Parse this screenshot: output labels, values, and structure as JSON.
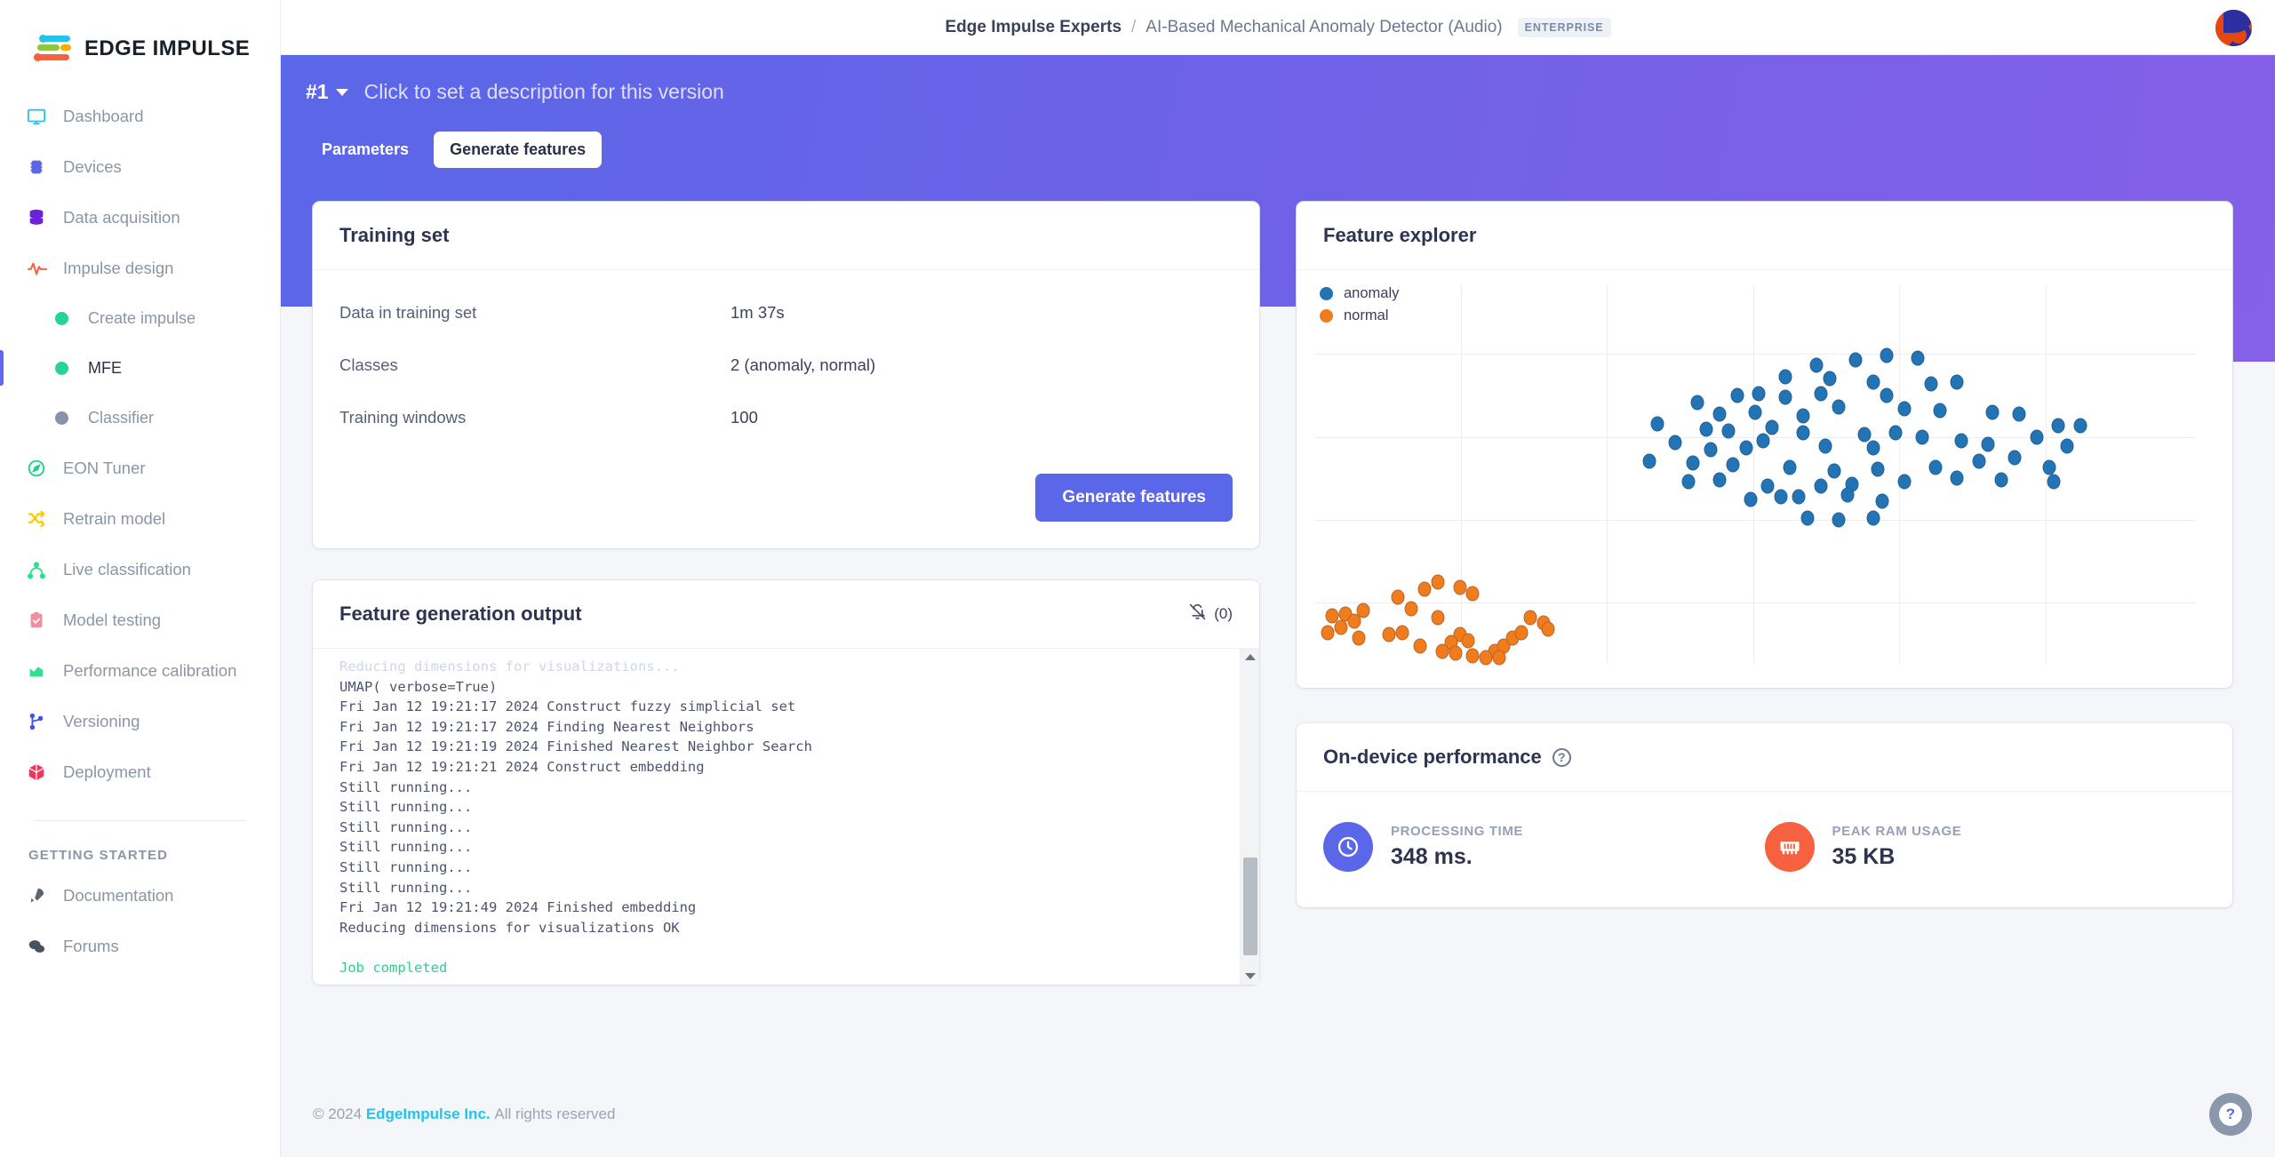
{
  "brand": {
    "name": "EDGE IMPULSE"
  },
  "sidebar": {
    "items": [
      {
        "label": "Dashboard",
        "icon": "monitor-icon"
      },
      {
        "label": "Devices",
        "icon": "chip-icon"
      },
      {
        "label": "Data acquisition",
        "icon": "database-icon"
      },
      {
        "label": "Impulse design",
        "icon": "waveform-icon"
      },
      {
        "label": "Create impulse",
        "icon": "dot-icon"
      },
      {
        "label": "MFE",
        "icon": "dot-icon"
      },
      {
        "label": "Classifier",
        "icon": "dot-icon"
      },
      {
        "label": "EON Tuner",
        "icon": "compass-icon"
      },
      {
        "label": "Retrain model",
        "icon": "shuffle-icon"
      },
      {
        "label": "Live classification",
        "icon": "network-icon"
      },
      {
        "label": "Model testing",
        "icon": "clipboard-check-icon"
      },
      {
        "label": "Performance calibration",
        "icon": "chart-icon"
      },
      {
        "label": "Versioning",
        "icon": "branch-icon"
      },
      {
        "label": "Deployment",
        "icon": "box-icon"
      }
    ],
    "section_title": "GETTING STARTED",
    "footer_items": [
      {
        "label": "Documentation",
        "icon": "rocket-icon"
      },
      {
        "label": "Forums",
        "icon": "chat-icon"
      }
    ]
  },
  "header": {
    "org": "Edge Impulse Experts",
    "separator": "/",
    "project": "AI-Based Mechanical Anomaly Detector (Audio)",
    "badge": "ENTERPRISE",
    "avatar": "user-avatar"
  },
  "banner": {
    "version": "#1",
    "description": "Click to set a description for this version",
    "tabs": [
      {
        "label": "Parameters",
        "active": false
      },
      {
        "label": "Generate features",
        "active": true
      }
    ]
  },
  "training_set": {
    "title": "Training set",
    "rows": [
      {
        "key": "Data in training set",
        "value": "1m 37s"
      },
      {
        "key": "Classes",
        "value": "2 (anomaly, normal)"
      },
      {
        "key": "Training windows",
        "value": "100"
      }
    ],
    "button": "Generate features"
  },
  "feature_output": {
    "title": "Feature generation output",
    "mute_label": "(0)",
    "mute_icon": "bell-off-icon",
    "lines": [
      {
        "text": "Reducing dimensions for visualizations...",
        "style": "faded"
      },
      {
        "text": "UMAP( verbose=True)",
        "style": "normal"
      },
      {
        "text": "Fri Jan 12 19:21:17 2024 Construct fuzzy simplicial set",
        "style": "normal"
      },
      {
        "text": "Fri Jan 12 19:21:17 2024 Finding Nearest Neighbors",
        "style": "normal"
      },
      {
        "text": "Fri Jan 12 19:21:19 2024 Finished Nearest Neighbor Search",
        "style": "normal"
      },
      {
        "text": "Fri Jan 12 19:21:21 2024 Construct embedding",
        "style": "normal"
      },
      {
        "text": "Still running...",
        "style": "normal"
      },
      {
        "text": "Still running...",
        "style": "normal"
      },
      {
        "text": "Still running...",
        "style": "normal"
      },
      {
        "text": "Still running...",
        "style": "normal"
      },
      {
        "text": "Still running...",
        "style": "normal"
      },
      {
        "text": "Still running...",
        "style": "normal"
      },
      {
        "text": "Fri Jan 12 19:21:49 2024 Finished embedding",
        "style": "normal"
      },
      {
        "text": "Reducing dimensions for visualizations OK",
        "style": "normal"
      },
      {
        "text": "",
        "style": "normal"
      },
      {
        "text": "Job completed",
        "style": "ok"
      }
    ]
  },
  "feature_explorer": {
    "title": "Feature explorer"
  },
  "chart_data": {
    "type": "scatter",
    "title": "Feature explorer",
    "xlabel": "",
    "ylabel": "",
    "xlim": [
      0,
      100
    ],
    "ylim": [
      0,
      100
    ],
    "grid": true,
    "legend_position": "top-left",
    "series": [
      {
        "name": "anomaly",
        "color": "#2274b5",
        "points": [
          [
            57.0,
            79.0
          ],
          [
            61.5,
            80.5
          ],
          [
            65.0,
            81.5
          ],
          [
            68.5,
            81.0
          ],
          [
            53.5,
            76.0
          ],
          [
            58.5,
            75.5
          ],
          [
            63.5,
            74.5
          ],
          [
            70.0,
            74.0
          ],
          [
            73.0,
            74.5
          ],
          [
            48.0,
            71.0
          ],
          [
            50.5,
            71.5
          ],
          [
            53.5,
            70.5
          ],
          [
            57.5,
            71.5
          ],
          [
            65.0,
            71.0
          ],
          [
            43.5,
            69.0
          ],
          [
            46.0,
            66.0
          ],
          [
            50.0,
            66.5
          ],
          [
            55.5,
            65.5
          ],
          [
            59.5,
            68.0
          ],
          [
            67.0,
            67.5
          ],
          [
            71.0,
            67.0
          ],
          [
            77.0,
            66.5
          ],
          [
            80.0,
            66.0
          ],
          [
            39.0,
            63.5
          ],
          [
            44.5,
            62.0
          ],
          [
            47.0,
            61.5
          ],
          [
            52.0,
            62.5
          ],
          [
            55.5,
            61.0
          ],
          [
            62.5,
            60.5
          ],
          [
            66.0,
            61.0
          ],
          [
            69.0,
            60.0
          ],
          [
            84.5,
            63.0
          ],
          [
            87.0,
            63.0
          ],
          [
            41.0,
            58.5
          ],
          [
            45.0,
            56.5
          ],
          [
            49.0,
            57.0
          ],
          [
            51.0,
            59.0
          ],
          [
            58.0,
            57.5
          ],
          [
            63.5,
            57.0
          ],
          [
            73.5,
            59.0
          ],
          [
            76.5,
            58.0
          ],
          [
            82.0,
            60.0
          ],
          [
            85.5,
            57.5
          ],
          [
            38.0,
            53.5
          ],
          [
            43.0,
            53.0
          ],
          [
            47.5,
            52.5
          ],
          [
            54.0,
            52.0
          ],
          [
            59.0,
            51.0
          ],
          [
            64.0,
            51.5
          ],
          [
            70.5,
            52.0
          ],
          [
            75.5,
            53.5
          ],
          [
            79.5,
            54.5
          ],
          [
            83.5,
            52.0
          ],
          [
            42.5,
            48.0
          ],
          [
            46.0,
            48.5
          ],
          [
            51.5,
            47.0
          ],
          [
            57.5,
            47.0
          ],
          [
            61.0,
            47.5
          ],
          [
            67.0,
            48.0
          ],
          [
            73.0,
            49.0
          ],
          [
            78.0,
            48.5
          ],
          [
            84.0,
            48.0
          ],
          [
            49.5,
            43.5
          ],
          [
            53.0,
            44.0
          ],
          [
            55.0,
            44.0
          ],
          [
            60.5,
            44.5
          ],
          [
            64.5,
            43.0
          ],
          [
            56.0,
            38.5
          ],
          [
            59.5,
            38.0
          ],
          [
            63.5,
            38.5
          ]
        ]
      },
      {
        "name": "normal",
        "color": "#f07c1e",
        "points": [
          [
            12.5,
            19.5
          ],
          [
            14.0,
            21.5
          ],
          [
            16.5,
            20.0
          ],
          [
            18.0,
            18.5
          ],
          [
            9.5,
            17.5
          ],
          [
            11.0,
            14.5
          ],
          [
            2.0,
            12.5
          ],
          [
            3.5,
            13.0
          ],
          [
            5.5,
            14.0
          ],
          [
            4.5,
            11.0
          ],
          [
            3.0,
            9.5
          ],
          [
            1.5,
            8.0
          ],
          [
            5.0,
            6.5
          ],
          [
            8.5,
            7.5
          ],
          [
            10.0,
            8.0
          ],
          [
            14.0,
            12.0
          ],
          [
            16.5,
            7.5
          ],
          [
            17.5,
            6.0
          ],
          [
            15.5,
            5.5
          ],
          [
            12.0,
            4.5
          ],
          [
            14.5,
            3.0
          ],
          [
            16.0,
            2.5
          ],
          [
            18.0,
            2.0
          ],
          [
            20.5,
            3.0
          ],
          [
            21.5,
            4.5
          ],
          [
            22.5,
            6.5
          ],
          [
            23.5,
            8.0
          ],
          [
            24.5,
            12.0
          ],
          [
            26.0,
            10.5
          ],
          [
            26.5,
            9.0
          ],
          [
            19.5,
            1.5
          ],
          [
            21.0,
            1.5
          ]
        ]
      }
    ]
  },
  "on_device": {
    "title": "On-device performance",
    "help_icon": "question-circle-icon",
    "metrics": [
      {
        "label": "PROCESSING TIME",
        "value": "348 ms.",
        "icon": "clock-icon",
        "color": "#5a67e8"
      },
      {
        "label": "PEAK RAM USAGE",
        "value": "35 KB",
        "icon": "ram-icon",
        "color": "#f6623f"
      }
    ]
  },
  "footer": {
    "copyright": "© 2024",
    "company": "EdgeImpulse Inc.",
    "rights": "All rights reserved",
    "help": "?"
  }
}
